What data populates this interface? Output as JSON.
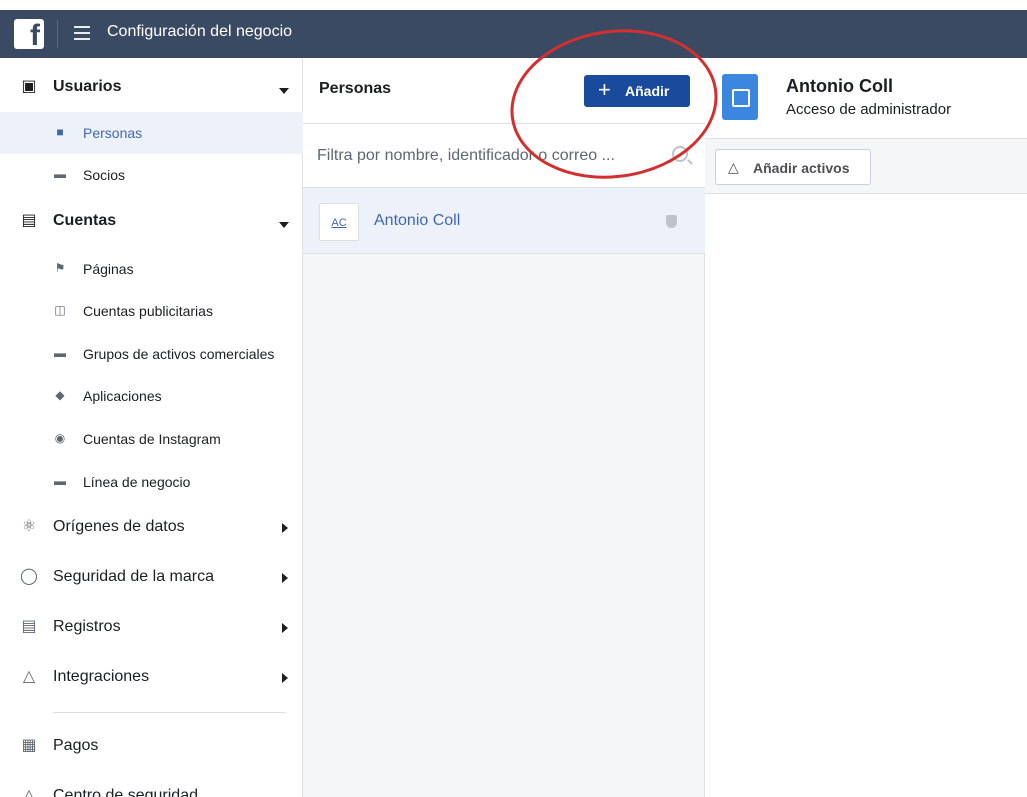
{
  "header": {
    "title": "Configuración del negocio"
  },
  "sidebar": {
    "groups": [
      {
        "label": "Usuarios",
        "icon": "users-icon",
        "items": [
          {
            "label": "Personas",
            "icon": "person-icon",
            "active": true
          },
          {
            "label": "Socios",
            "icon": "briefcase-icon"
          }
        ]
      },
      {
        "label": "Cuentas",
        "icon": "archive-icon",
        "items": [
          {
            "label": "Páginas",
            "icon": "flag-icon"
          },
          {
            "label": "Cuentas publicitarias",
            "icon": "ad-account-icon"
          },
          {
            "label": "Grupos de activos comerciales",
            "icon": "folder-icon"
          },
          {
            "label": "Aplicaciones",
            "icon": "cube-icon"
          },
          {
            "label": "Cuentas de Instagram",
            "icon": "instagram-icon"
          },
          {
            "label": "Línea de negocio",
            "icon": "briefcase-icon"
          }
        ]
      }
    ],
    "sections": [
      {
        "label": "Orígenes de datos",
        "icon": "data-sources-icon"
      },
      {
        "label": "Seguridad de la marca",
        "icon": "shield-icon"
      },
      {
        "label": "Registros",
        "icon": "clipboard-icon"
      },
      {
        "label": "Integraciones",
        "icon": "integrations-icon"
      }
    ],
    "bottom": [
      {
        "label": "Pagos",
        "icon": "bank-icon"
      },
      {
        "label": "Centro de seguridad",
        "icon": "lock-icon"
      }
    ]
  },
  "people_panel": {
    "title": "Personas",
    "add_label": "Añadir",
    "search_placeholder": "Filtra por nombre, identificador o correo ...",
    "rows": [
      {
        "initials": "AC",
        "name": "Antonio Coll"
      }
    ]
  },
  "detail_panel": {
    "name": "Antonio Coll",
    "role": "Acceso de administrador",
    "add_assets_label": "Añadir activos"
  },
  "colors": {
    "topbar": "#3b4a63",
    "primary_button": "#1a4a9c",
    "link": "#4267b2",
    "annotation": "#d32f2f"
  }
}
